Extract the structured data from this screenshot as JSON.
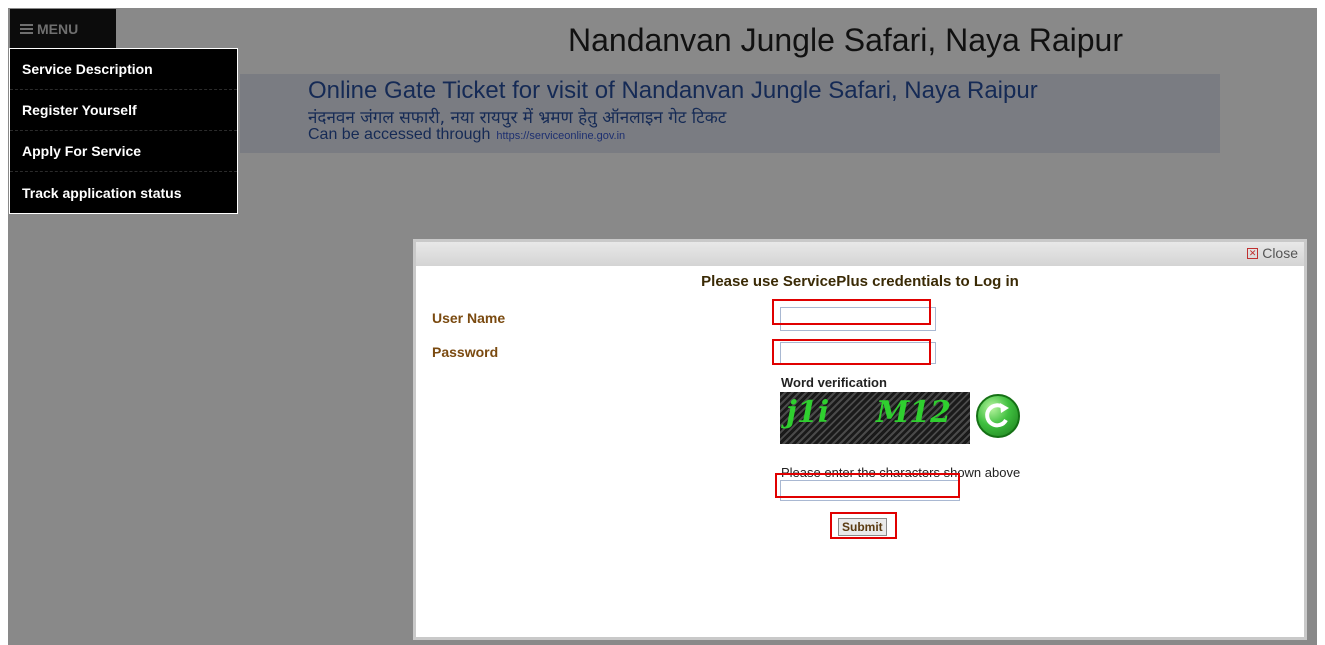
{
  "menu": {
    "button_label": "MENU",
    "items": [
      "Service Description",
      "Register Yourself",
      "Apply For Service",
      "Track application status"
    ]
  },
  "page": {
    "title": "Nandanvan Jungle Safari, Naya Raipur",
    "banner_line1": "Online Gate Ticket for visit of Nandanvan Jungle Safari, Naya Raipur",
    "banner_line2": "नंदनवन जंगल सफारी, नया रायपुर में भ्रमण हेतु ऑनलाइन गेट टिकट",
    "banner_line3": "Can be accessed through",
    "banner_url": "https://serviceonline.gov.in"
  },
  "login_dialog": {
    "close_label": "Close",
    "heading": "Please use ServicePlus credentials to Log in",
    "username_label": "User Name",
    "username_value": "",
    "password_label": "Password",
    "password_value": "",
    "word_verification_label": "Word verification",
    "captcha_text_1": "j1i",
    "captcha_text_2": "M12",
    "captcha_hint": "Please enter the characters shown above",
    "captcha_value": "",
    "submit_label": "Submit"
  }
}
